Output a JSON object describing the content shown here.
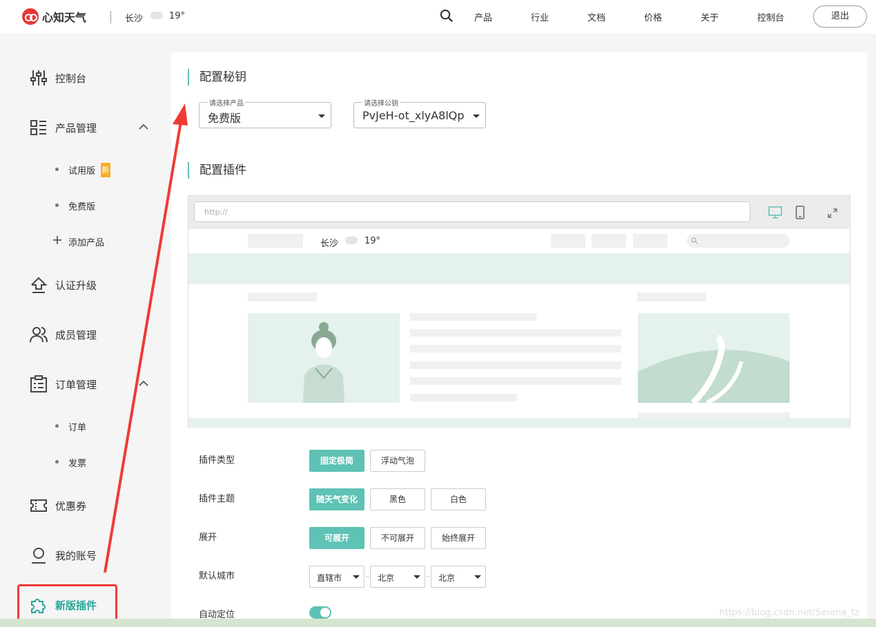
{
  "header": {
    "brand": "心知天气",
    "city": "长沙",
    "temperature": "19°",
    "nav": [
      "产品",
      "行业",
      "文档",
      "价格",
      "关于",
      "控制台"
    ],
    "logout_label": "退出"
  },
  "sidebar": {
    "items": [
      {
        "label": "控制台",
        "icon": "sliders-icon"
      },
      {
        "label": "产品管理",
        "icon": "grid-list-icon"
      },
      {
        "label": "认证升级",
        "icon": "upgrade-icon"
      },
      {
        "label": "成员管理",
        "icon": "users-icon"
      },
      {
        "label": "订单管理",
        "icon": "clipboard-icon"
      },
      {
        "label": "优惠券",
        "icon": "ticket-icon"
      },
      {
        "label": "我的账号",
        "icon": "user-icon"
      },
      {
        "label": "新版插件",
        "icon": "puzzle-icon"
      }
    ],
    "product_subs": [
      "试用版",
      "免费版",
      "添加产品"
    ],
    "new_badge": "新",
    "order_subs": [
      "订单",
      "发票"
    ]
  },
  "config_key": {
    "title": "配置秘钥",
    "product_legend": "请选择产品",
    "product_value": "免费版",
    "key_legend": "请选择公钥",
    "key_value": "PvJeH-ot_xlyA8lQp"
  },
  "plugin": {
    "title": "配置插件",
    "url_placeholder": "http://",
    "preview_city": "长沙",
    "preview_temp": "19°"
  },
  "options": {
    "type_label": "插件类型",
    "type_buttons": [
      "固定极简",
      "浮动气泡"
    ],
    "theme_label": "插件主题",
    "theme_buttons": [
      "随天气变化",
      "黑色",
      "白色"
    ],
    "expand_label": "展开",
    "expand_buttons": [
      "可展开",
      "不可展开",
      "始终展开"
    ],
    "city_label": "默认城市",
    "city_selects": [
      "直辖市",
      "北京",
      "北京"
    ],
    "locate_label": "自动定位"
  },
  "watermark": "https://blog.csdn.net/Serena_tz",
  "colors": {
    "accent": "#5ec2b4",
    "brand_red": "#e53935",
    "annotation_red": "#ef3b36"
  }
}
